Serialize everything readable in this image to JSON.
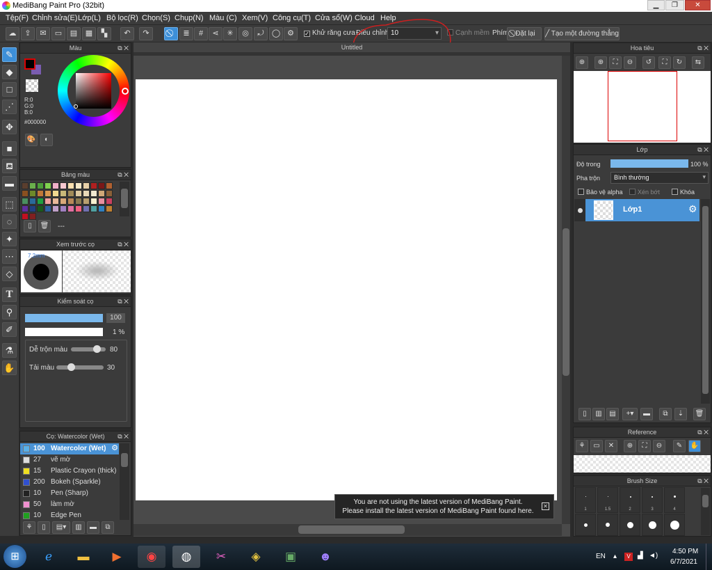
{
  "window": {
    "title": "MediBang Paint Pro (32bit)"
  },
  "menu": [
    "Tệp(F)",
    "Chỉnh sửa(E)",
    "Lớp(L)",
    "Bộ lọc(R)",
    "Chọn(S)",
    "Chụp(N)",
    "Màu (C)",
    "Xem(V)",
    "Công cụ(T)",
    "Cửa sổ(W)",
    "Cloud",
    "Help"
  ],
  "toolbar": {
    "antialias_label": "Khử răng cưa",
    "antialias_checked": true,
    "correction_label": "Điều chỉnh",
    "correction_value": "10",
    "soft_edge_label": "Cạnh mềm",
    "key_label": "Phím",
    "reset_label": "Đặt lại",
    "straight_line_label": "Tạo một đường thẳng"
  },
  "color_panel": {
    "title": "Màu",
    "r": "R:0",
    "g": "G:0",
    "b": "B:0",
    "hex": "#000000",
    "fg_color": "#000000",
    "bg_color": "#7a5cb0",
    "hue_color": "#ff0000"
  },
  "palette_panel": {
    "title": "Bảng màu",
    "extra": "---",
    "swatches": [
      "#5a3e2e",
      "#6ab04c",
      "#4d9e3a",
      "#7fd14f",
      "#f0b0c8",
      "#f8c8d0",
      "#fce0b0",
      "#f5e8c8",
      "#e8d0a8",
      "#b02020",
      "#7a1818",
      "#b06030",
      "#8a5020",
      "#6e8a2a",
      "#c07838",
      "#d89850",
      "#f0d890",
      "#c8b878",
      "#a08a58",
      "#dcc8a0",
      "#e8d8b8",
      "#f0e8d0",
      "#d0a878",
      "#8a6038",
      "#4a9060",
      "#2a6a9a",
      "#20a040",
      "#f0a0a0",
      "#e8b898",
      "#d8a878",
      "#b88858",
      "#8a7a50",
      "#b8a070",
      "#f8f0d0",
      "#e890a0",
      "#c84060",
      "#6030a0",
      "#204080",
      "#1a5a1a",
      "#3060a0",
      "#c0a0c8",
      "#a080c0",
      "#e070a0",
      "#f06080",
      "#7070b0",
      "#50a0a0",
      "#3080c0",
      "#c08030",
      "#c01020",
      "#802020"
    ]
  },
  "preview_panel": {
    "title": "Xem trước cọ",
    "size_label": "7.2mm"
  },
  "brush_control": {
    "title": "Kiểm soát cọ",
    "size_value": "100",
    "opacity_value": "1 %",
    "blend_label": "Dễ trộn màu",
    "blend_value": "80",
    "reload_label": "Tải màu",
    "reload_value": "30"
  },
  "brush_list": {
    "title": "Cọ: Watercolor (Wet)",
    "items": [
      {
        "size": "100",
        "name": "Watercolor (Wet)",
        "color": "#5ab0e8"
      },
      {
        "size": "27",
        "name": "vẽ mờ",
        "color": "#dddddd"
      },
      {
        "size": "15",
        "name": "Plastic Crayon (thick)",
        "color": "#f0e020"
      },
      {
        "size": "200",
        "name": "Bokeh (Sparkle)",
        "color": "#3050d0"
      },
      {
        "size": "10",
        "name": "Pen (Sharp)",
        "color": "#222222"
      },
      {
        "size": "50",
        "name": "làm mờ",
        "color": "#f090d0"
      },
      {
        "size": "10",
        "name": "Edge Pen",
        "color": "#20a020"
      }
    ]
  },
  "canvas": {
    "title": "Untitled"
  },
  "notification": {
    "line1": "You are not using the latest version of MediBang Paint.",
    "line2": "Please install the latest version of MediBang Paint found here."
  },
  "navigator": {
    "title": "Hoa tiêu"
  },
  "layer_panel": {
    "title": "Lớp",
    "opacity_label": "Độ trong",
    "opacity_value": "100 %",
    "blend_label": "Pha trộn",
    "blend_value": "Bình thường",
    "protect_alpha": "Bảo vệ alpha",
    "clip": "Xén bớt",
    "lock": "Khóa",
    "layer_name": "Lớp1"
  },
  "reference": {
    "title": "Reference"
  },
  "brush_size": {
    "title": "Brush Size",
    "row1": [
      "1",
      "1.5",
      "2",
      "3",
      "4"
    ]
  },
  "taskbar": {
    "lang": "EN",
    "time": "4:50 PM",
    "date": "6/7/2021"
  }
}
